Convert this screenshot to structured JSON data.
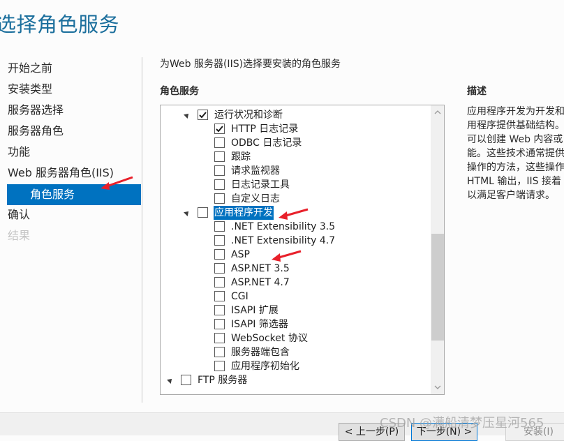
{
  "page": {
    "title": "选择角色服务",
    "subtitle": "为Web 服务器(IIS)选择要安装的角色服务",
    "section_label": "角色服务",
    "accent_color": "#0072c0"
  },
  "nav": {
    "items": [
      {
        "label": "开始之前",
        "state": "normal"
      },
      {
        "label": "安装类型",
        "state": "normal"
      },
      {
        "label": "服务器选择",
        "state": "normal"
      },
      {
        "label": "服务器角色",
        "state": "normal"
      },
      {
        "label": "功能",
        "state": "normal"
      },
      {
        "label": "Web 服务器角色(IIS)",
        "state": "normal"
      },
      {
        "label": "角色服务",
        "state": "selected"
      },
      {
        "label": "确认",
        "state": "normal"
      },
      {
        "label": "结果",
        "state": "disabled"
      }
    ]
  },
  "tree": {
    "items": [
      {
        "label": "运行状况和诊断",
        "level": 1,
        "expandable": true,
        "checked": true
      },
      {
        "label": "HTTP 日志记录",
        "level": 2,
        "checked": true
      },
      {
        "label": "ODBC 日志记录",
        "level": 2,
        "checked": false
      },
      {
        "label": "跟踪",
        "level": 2,
        "checked": false
      },
      {
        "label": "请求监视器",
        "level": 2,
        "checked": false
      },
      {
        "label": "日志记录工具",
        "level": 2,
        "checked": false
      },
      {
        "label": "自定义日志",
        "level": 2,
        "checked": false
      },
      {
        "label": "应用程序开发",
        "level": 1,
        "expandable": true,
        "checked": false,
        "selected": true
      },
      {
        "label": ".NET Extensibility 3.5",
        "level": 2,
        "checked": false
      },
      {
        "label": ".NET Extensibility 4.7",
        "level": 2,
        "checked": false
      },
      {
        "label": "ASP",
        "level": 2,
        "checked": false
      },
      {
        "label": "ASP.NET 3.5",
        "level": 2,
        "checked": false
      },
      {
        "label": "ASP.NET 4.7",
        "level": 2,
        "checked": false
      },
      {
        "label": "CGI",
        "level": 2,
        "checked": false
      },
      {
        "label": "ISAPI 扩展",
        "level": 2,
        "checked": false
      },
      {
        "label": "ISAPI 筛选器",
        "level": 2,
        "checked": false
      },
      {
        "label": "WebSocket 协议",
        "level": 2,
        "checked": false
      },
      {
        "label": "服务器端包含",
        "level": 2,
        "checked": false
      },
      {
        "label": "应用程序初始化",
        "level": 2,
        "checked": false
      },
      {
        "label": "FTP 服务器",
        "level": 0,
        "expandable": true,
        "checked": false
      }
    ]
  },
  "description": {
    "title": "描述",
    "lines": [
      "应用程序开发为开发和",
      "用程序提供基础结构。",
      "可以创建 Web 内容或",
      "能。这些技术通常提供",
      "操作的方法，这些操作",
      "HTML 输出，IIS 接着",
      "以满足客户端请求。"
    ]
  },
  "footer": {
    "prev_label": "< 上一步(P)",
    "next_label": "下一步(N) >",
    "install_label": "安装(I)"
  },
  "watermark": "CSDN @满船清梦压星河565",
  "annotation_color": "#e8202a"
}
